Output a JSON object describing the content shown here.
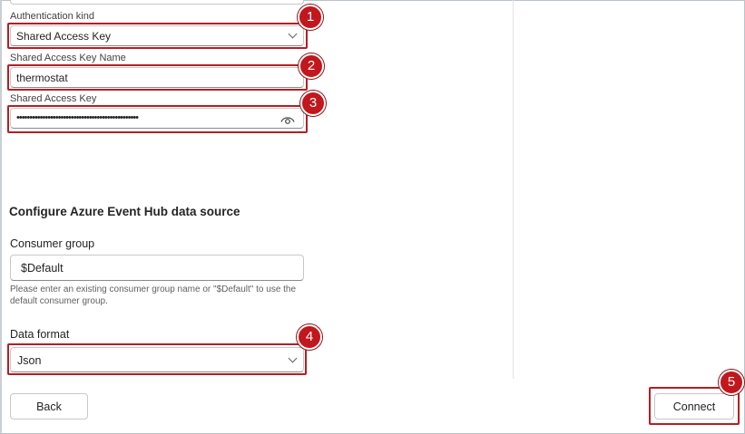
{
  "connection": {
    "cutoff_text": "",
    "auth_kind": {
      "label": "Authentication kind",
      "value": "Shared Access Key"
    },
    "sak_name": {
      "label": "Shared Access Key Name",
      "value": "thermostat"
    },
    "sak": {
      "label": "Shared Access Key",
      "value": "•••••••••••••••••••••••••••••••••••••••••••••••"
    }
  },
  "event_hub": {
    "section_title": "Configure Azure Event Hub data source",
    "consumer_group": {
      "label": "Consumer group",
      "value": "$Default",
      "help": "Please enter an existing consumer group name or \"$Default\" to use the default consumer group."
    },
    "data_format": {
      "label": "Data format",
      "value": "Json"
    }
  },
  "footer": {
    "back_label": "Back",
    "connect_label": "Connect"
  },
  "callouts": [
    "1",
    "2",
    "3",
    "4",
    "5"
  ],
  "colors": {
    "callout": "#c1171d",
    "highlight": "#b21f24"
  },
  "icons": {
    "dropdown": "chevron-down-icon",
    "reveal": "eye-icon"
  }
}
